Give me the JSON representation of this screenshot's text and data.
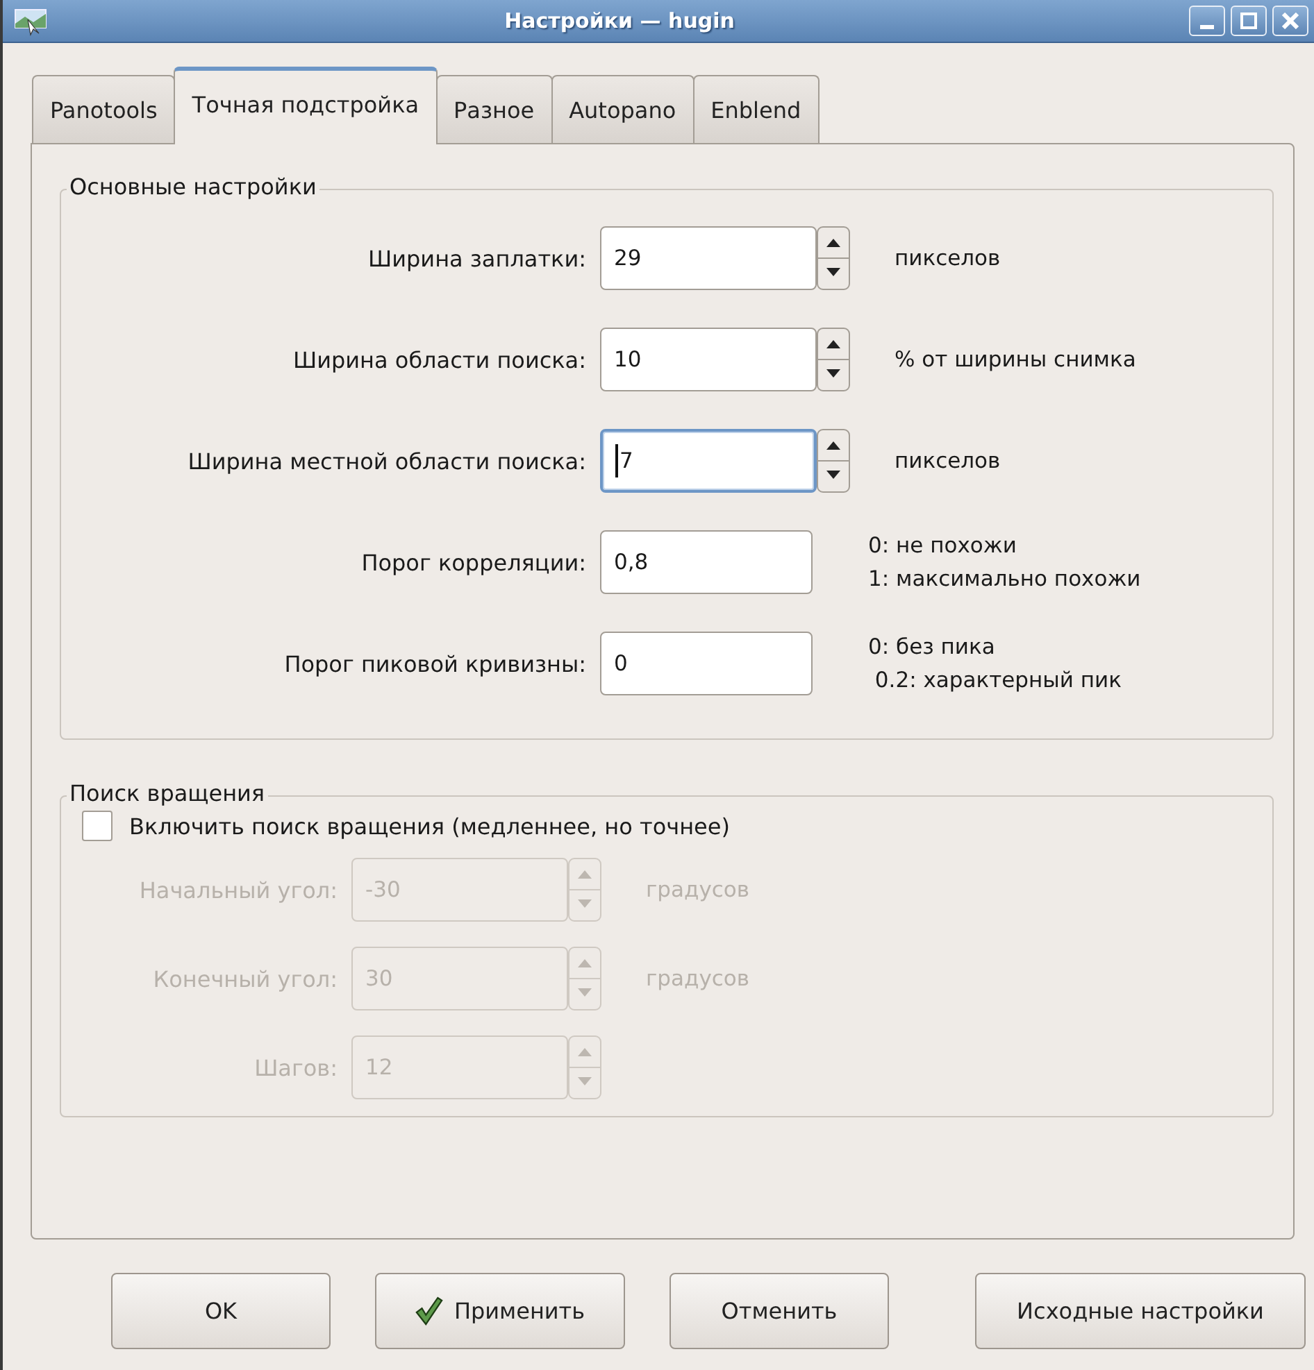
{
  "window": {
    "title": "Настройки — hugin"
  },
  "tabs": [
    {
      "label": "Panotools",
      "selected": false
    },
    {
      "label": "Точная подстройка",
      "selected": true
    },
    {
      "label": "Разное",
      "selected": false
    },
    {
      "label": "Autopano",
      "selected": false
    },
    {
      "label": "Enblend",
      "selected": false
    }
  ],
  "basic_settings": {
    "title": "Основные настройки",
    "rows": [
      {
        "label": "Ширина заплатки:",
        "kind": "spin",
        "value": "29",
        "focused": false,
        "unit": "пикселов"
      },
      {
        "label": "Ширина области поиска:",
        "kind": "spin",
        "value": "10",
        "focused": false,
        "unit": "% от ширины снимка"
      },
      {
        "label": "Ширина местной области поиска:",
        "kind": "spin",
        "value": "7",
        "focused": true,
        "unit": "пикселов"
      },
      {
        "label": "Порог корреляции:",
        "kind": "text",
        "value": "0,8",
        "focused": false,
        "hints": [
          "0: не похожи",
          "1: максимально похожи"
        ]
      },
      {
        "label": "Порог пиковой кривизны:",
        "kind": "text",
        "value": "0",
        "focused": false,
        "hints": [
          "0: без пика",
          " 0.2: характерный пик"
        ]
      }
    ]
  },
  "rotation_search": {
    "title": "Поиск вращения",
    "checkbox": {
      "label": "Включить поиск вращения (медленнее, но точнее)",
      "checked": false
    },
    "rows": [
      {
        "label": "Начальный угол:",
        "kind": "spin",
        "value": "-30",
        "disabled": true,
        "unit": "градусов"
      },
      {
        "label": "Конечный угол:",
        "kind": "spin",
        "value": "30",
        "disabled": true,
        "unit": "градусов"
      },
      {
        "label": "Шагов:",
        "kind": "spin",
        "value": "12",
        "disabled": true
      }
    ]
  },
  "buttons": [
    {
      "label": "OK",
      "kind": "plain"
    },
    {
      "label": "Применить",
      "kind": "check"
    },
    {
      "label": "Отменить",
      "kind": "plain"
    },
    {
      "label": "Исходные настройки",
      "kind": "plain"
    }
  ]
}
